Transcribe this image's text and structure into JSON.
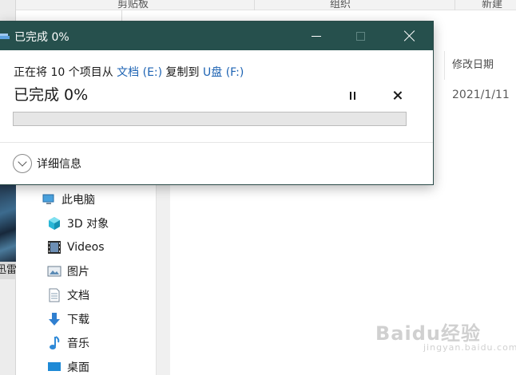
{
  "dialog": {
    "title": "已完成 0%",
    "copy_line": {
      "prefix": "正在将 10 个项目从 ",
      "source": "文档 (E:)",
      "middle": " 复制到 ",
      "destination": "U盘 (F:)"
    },
    "percent_label": "已完成 0%",
    "progress": 0,
    "details_label": "详细信息",
    "pause_icon": "pause-icon",
    "cancel_icon": "close-icon"
  },
  "explorer": {
    "ribbon_groups": [
      "剪贴板",
      "组织",
      "新建"
    ],
    "column_header": "修改日期",
    "row_date": "2021/1/11",
    "thumbnail_caption": "迅雷",
    "nav_items": [
      {
        "label": "此电脑",
        "icon": "computer-icon"
      },
      {
        "label": "3D 对象",
        "icon": "cube-3d-icon"
      },
      {
        "label": "Videos",
        "icon": "video-icon"
      },
      {
        "label": "图片",
        "icon": "picture-icon"
      },
      {
        "label": "文档",
        "icon": "document-icon"
      },
      {
        "label": "下载",
        "icon": "download-icon"
      },
      {
        "label": "音乐",
        "icon": "music-icon"
      },
      {
        "label": "桌面",
        "icon": "desktop-icon"
      }
    ]
  },
  "watermark": {
    "text": "Baidu经验",
    "sub": "jingyan.baidu.com"
  },
  "colors": {
    "titlebar": "#26504d",
    "link": "#1d63b3",
    "progress": "#06b025"
  }
}
